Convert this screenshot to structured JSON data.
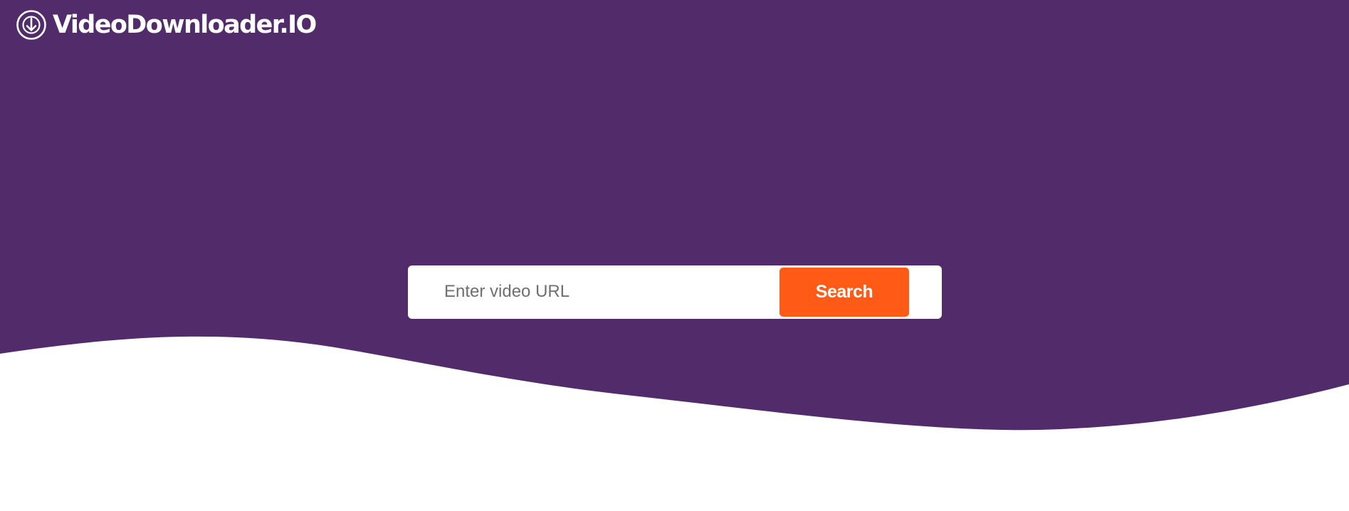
{
  "brand": {
    "name": "VideoDownloader.IO",
    "icon": "download-circle-icon"
  },
  "search": {
    "placeholder": "Enter video URL",
    "value": "",
    "button_label": "Search"
  },
  "colors": {
    "hero_background": "#522b6b",
    "page_background": "#ffffff",
    "accent": "#ff5a16",
    "logo_text": "#ffffff"
  }
}
